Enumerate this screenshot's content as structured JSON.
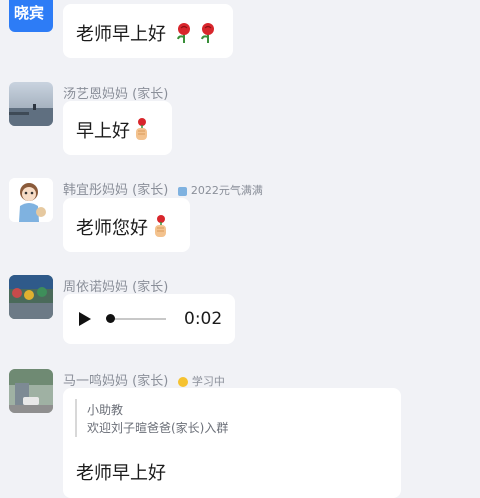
{
  "messages": [
    {
      "avatar_text": "晓宾",
      "text": "老师早上好"
    },
    {
      "sender": "汤艺恩妈妈 (家长)",
      "text": "早上好"
    },
    {
      "sender": "韩宜彤妈妈 (家长)",
      "badge": "2022元气满满",
      "text": "老师您好"
    },
    {
      "sender": "周依诺妈妈 (家长)",
      "voice_duration": "0:02"
    },
    {
      "sender": "马一鸣妈妈 (家长)",
      "badge": "学习中",
      "quote_author": "小助教",
      "quote_text": "欢迎刘子暄爸爸(家长)入群",
      "text": "老师早上好"
    }
  ],
  "colors": {
    "background": "#f1f2f6",
    "avatar_blue": "#2d7cf6",
    "bubble": "#ffffff"
  }
}
